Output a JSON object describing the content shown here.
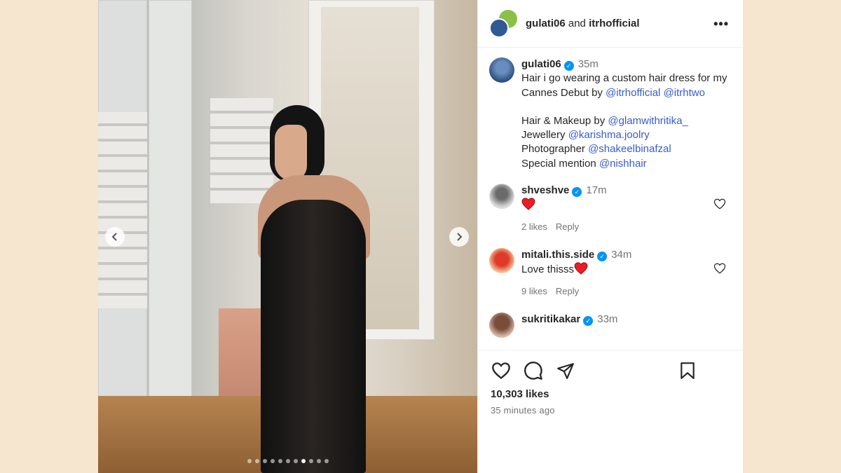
{
  "header": {
    "user1": "gulati06",
    "conjunction": "and",
    "user2": "itrhofficial",
    "more_icon": "more-horizontal-icon"
  },
  "media": {
    "carousel_count": 11,
    "carousel_active": 8
  },
  "caption": {
    "username": "gulati06",
    "time": "35m",
    "line1": "Hair i go wearing a custom hair dress for my Cannes Debut by",
    "mention1": "@itrhofficial",
    "mention2": "@itrhtwo",
    "credits": [
      {
        "label": "Hair & Makeup by",
        "mention": "@glamwithritika_"
      },
      {
        "label": "Jewellery",
        "mention": "@karishma.joolry"
      },
      {
        "label": "Photographer",
        "mention": "@shakeelbinafzal"
      },
      {
        "label": "Special mention",
        "mention": "@nishhair"
      }
    ]
  },
  "comments": [
    {
      "username": "shveshve",
      "time": "17m",
      "text": "",
      "emoji": "red-heart",
      "likes": "2 likes",
      "reply": "Reply"
    },
    {
      "username": "mitali.this.side",
      "time": "34m",
      "text": "Love thisss",
      "emoji": "red-heart",
      "likes": "9 likes",
      "reply": "Reply"
    },
    {
      "username": "sukritikakar",
      "time": "33m"
    }
  ],
  "footer": {
    "likes": "10,303 likes",
    "ago": "35 minutes ago"
  },
  "colors": {
    "background": "#f6e6cf",
    "mention": "#385cc9",
    "verified": "#0095f6",
    "heart": "#ed1c24"
  }
}
